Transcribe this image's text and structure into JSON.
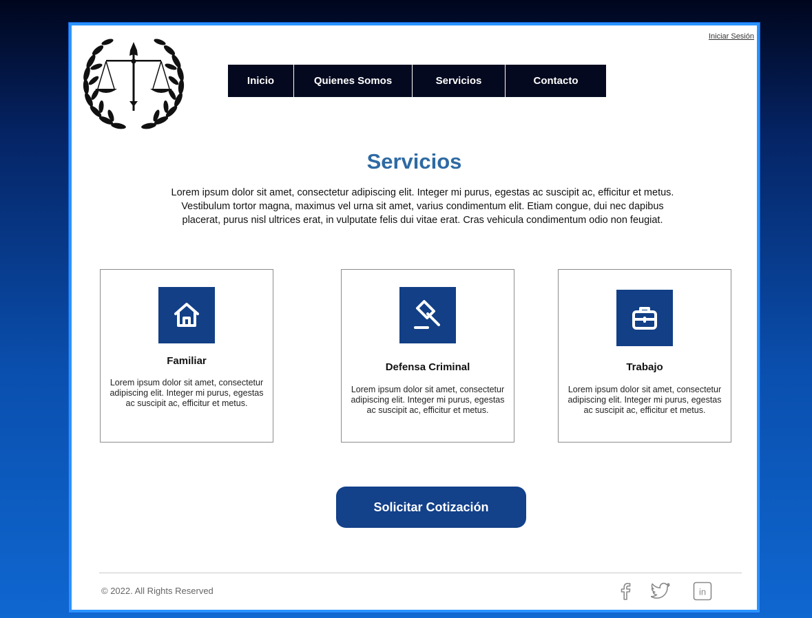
{
  "header": {
    "login_label": "Iniciar Sesión",
    "nav": [
      {
        "label": "Inicio"
      },
      {
        "label": "Quienes Somos"
      },
      {
        "label": "Servicios"
      },
      {
        "label": "Contacto"
      }
    ]
  },
  "main": {
    "title": "Servicios",
    "intro": "Lorem ipsum dolor sit amet, consectetur adipiscing elit. Integer mi purus, egestas ac suscipit ac, efficitur et metus. Vestibulum tortor magna, maximus vel urna sit amet, varius condimentum elit. Etiam congue, dui nec dapibus placerat, purus nisl ultrices erat, in vulputate felis dui vitae erat. Cras vehicula condimentum odio non feugiat.",
    "cards": [
      {
        "icon": "home-icon",
        "title": "Familiar",
        "description": "Lorem ipsum dolor sit amet, consectetur adipiscing elit. Integer mi purus, egestas ac suscipit ac, efficitur et metus."
      },
      {
        "icon": "gavel-icon",
        "title": "Defensa Criminal",
        "description": "Lorem ipsum dolor sit amet, consectetur adipiscing elit. Integer mi purus, egestas ac suscipit ac, efficitur et metus."
      },
      {
        "icon": "briefcase-icon",
        "title": "Trabajo",
        "description": "Lorem ipsum dolor sit amet, consectetur adipiscing elit. Integer mi purus, egestas ac suscipit ac, efficitur et metus."
      }
    ],
    "cta_label": "Solicitar Cotización"
  },
  "footer": {
    "copyright": "© 2022. All Rights Reserved",
    "social": [
      "facebook-icon",
      "twitter-icon",
      "linkedin-icon"
    ]
  },
  "colors": {
    "nav_bg": "#05091f",
    "accent_blue": "#13418a",
    "title_blue": "#2e6aa3",
    "frame_border": "#2a93ff"
  }
}
